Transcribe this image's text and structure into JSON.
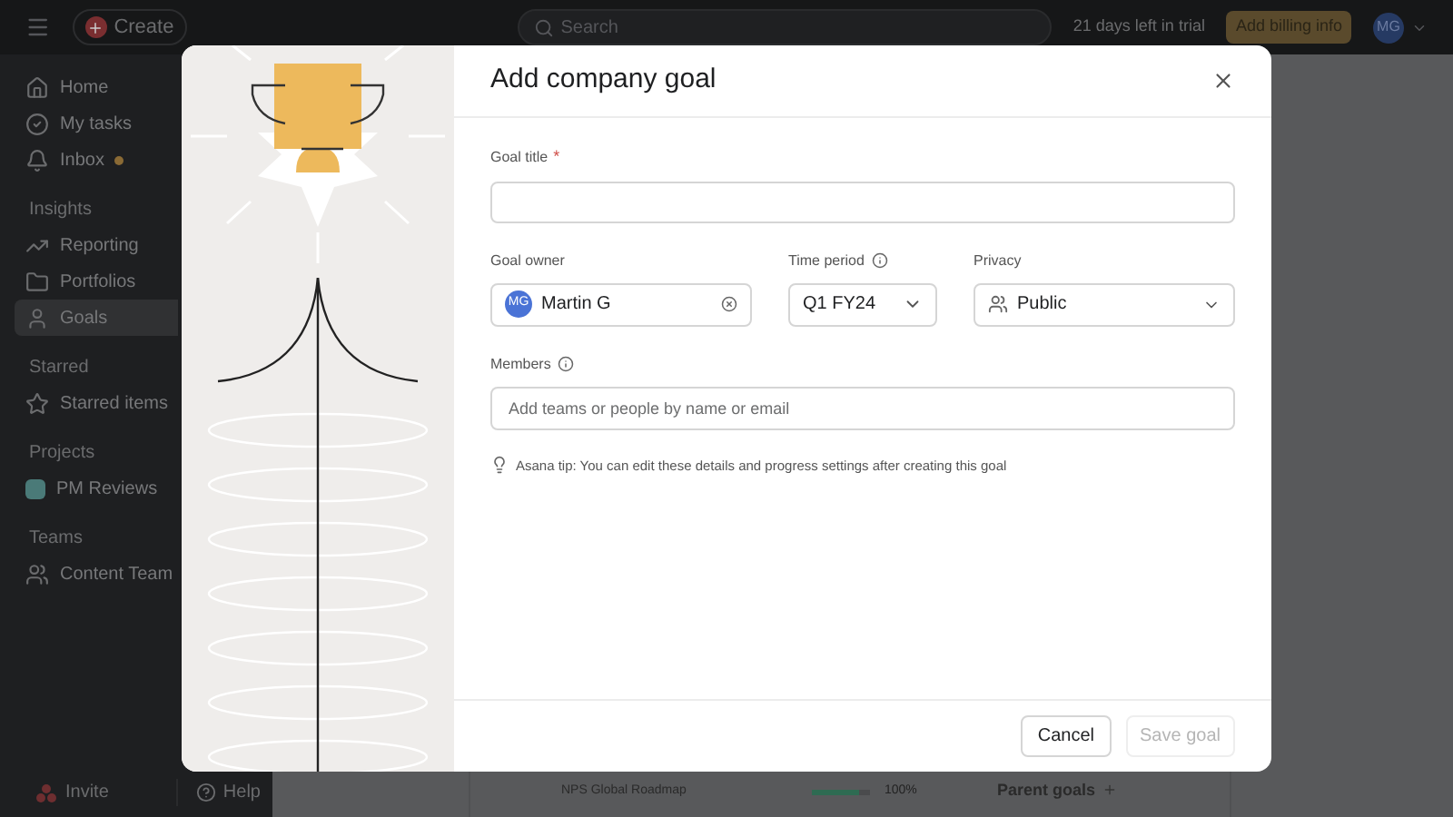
{
  "topbar": {
    "create": "Create",
    "search_placeholder": "Search",
    "trial": "21 days left in trial",
    "billing": "Add billing info",
    "avatar": "MG"
  },
  "sidebar": {
    "nav": [
      {
        "kind": "home",
        "label": "Home"
      },
      {
        "kind": "tasks",
        "label": "My tasks"
      },
      {
        "kind": "inbox",
        "label": "Inbox",
        "dot": true
      }
    ],
    "sections": [
      {
        "title": "Insights",
        "items": [
          {
            "kind": "reporting",
            "label": "Reporting",
            "selected": false
          },
          {
            "kind": "portfolios",
            "label": "Portfolios",
            "selected": false
          },
          {
            "kind": "goals",
            "label": "Goals",
            "selected": true
          }
        ]
      },
      {
        "title": "Starred",
        "items": [
          {
            "kind": "star",
            "label": "Starred items",
            "selected": false
          }
        ]
      },
      {
        "title": "Projects",
        "items": [
          {
            "kind": "project",
            "label": "PM Reviews",
            "selected": false,
            "color": "#4a7a78"
          }
        ]
      },
      {
        "title": "Teams",
        "items": [
          {
            "kind": "team",
            "label": "Content Team",
            "selected": false
          }
        ]
      }
    ],
    "invite": "Invite",
    "help": "Help"
  },
  "background": {
    "goals": [
      {
        "name": "NPS Global Roadmap",
        "level": 0.8,
        "percent": "100%"
      }
    ],
    "parent_goals": "Parent goals"
  },
  "dialog": {
    "title": "Add company goal",
    "goal_title": {
      "label": "Goal title",
      "required_mark": "*"
    },
    "owner": {
      "label": "Goal owner",
      "initials": "MG",
      "name": "Martin G"
    },
    "period": {
      "label": "Time period",
      "value": "Q1 FY24"
    },
    "privacy": {
      "label": "Privacy",
      "value": "Public"
    },
    "members": {
      "label": "Members",
      "placeholder": "Add teams or people by name or email"
    },
    "tip": "Asana tip: You can edit these details and progress settings after creating this goal",
    "cancel": "Cancel",
    "save": {
      "label": "Save goal",
      "disabled": true
    }
  }
}
